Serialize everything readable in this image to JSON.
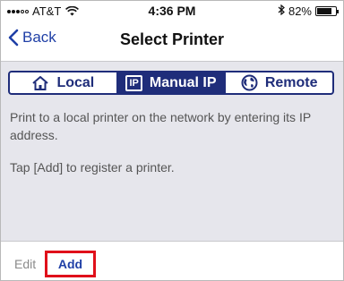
{
  "status_bar": {
    "carrier": "AT&T",
    "time": "4:36 PM",
    "battery_text": "82%",
    "battery_level": 0.82,
    "signal_bars_filled": 3,
    "signal_bars_total": 5
  },
  "nav": {
    "back_label": "Back",
    "title": "Select Printer"
  },
  "tabs": [
    {
      "label": "Local",
      "icon": "home-icon",
      "active": false
    },
    {
      "label": "Manual IP",
      "icon": "ip-icon",
      "icon_text": "IP",
      "active": true
    },
    {
      "label": "Remote",
      "icon": "globe-icon",
      "active": false
    }
  ],
  "content": {
    "description": "Print to a local printer on the network by entering its IP address.",
    "hint": "Tap [Add] to register a printer."
  },
  "toolbar": {
    "edit_label": "Edit",
    "add_label": "Add"
  },
  "colors": {
    "accent": "#1f2d7a",
    "link": "#1f3fa6",
    "highlight_border": "#e0101a",
    "content_bg": "#e6e6ec"
  }
}
